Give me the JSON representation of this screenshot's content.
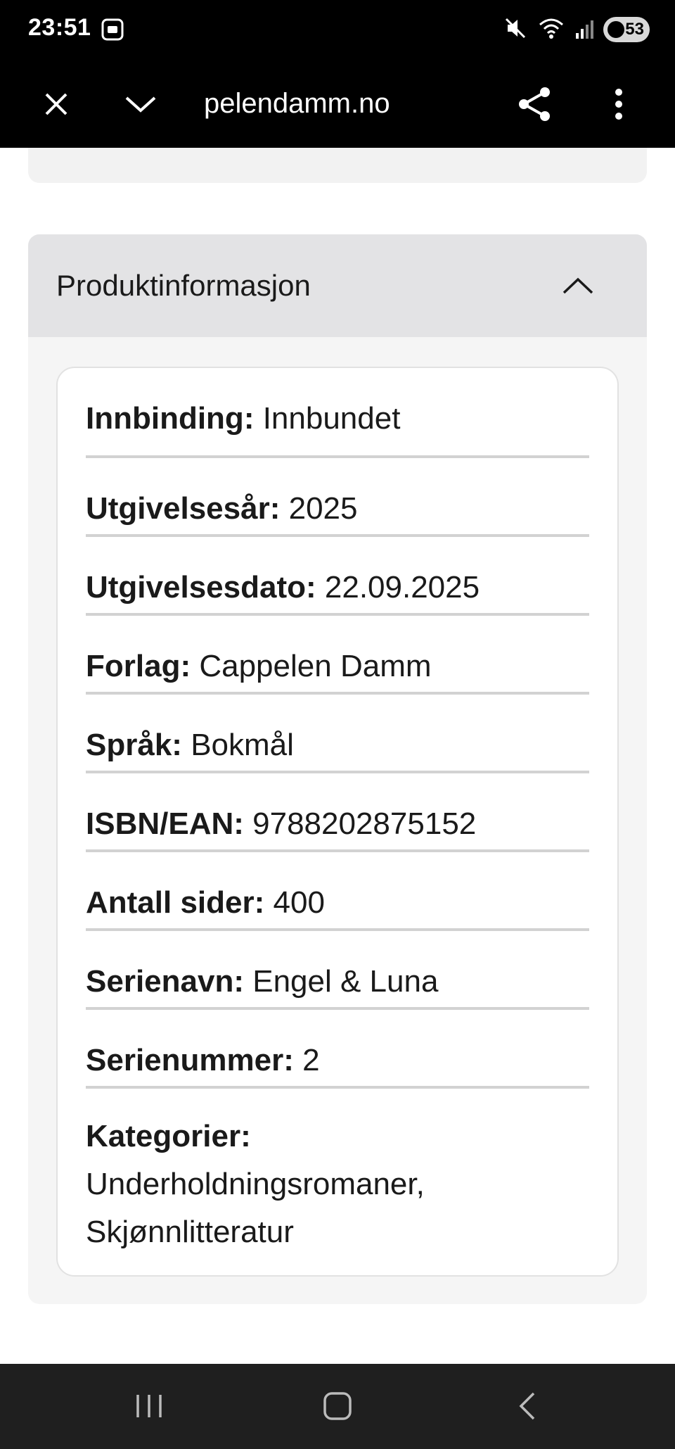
{
  "status_bar": {
    "time": "23:51",
    "battery": "53",
    "icons": [
      "screenshot-icon",
      "mute-icon",
      "wifi-icon",
      "signal-icon",
      "battery-icon"
    ]
  },
  "browser": {
    "url": "cappelendamm.no",
    "url_visible": "pelendamm.no",
    "icons": [
      "close-icon",
      "chevron-down-icon",
      "share-icon",
      "more-vert-icon"
    ]
  },
  "accordion": {
    "title": "Produktinformasjon",
    "expanded": true,
    "rows": [
      {
        "label": "Innbinding:",
        "value": "Innbundet"
      },
      {
        "label": "Utgivelsesår:",
        "value": "2025"
      },
      {
        "label": "Utgivelsesdato:",
        "value": "22.09.2025"
      },
      {
        "label": "Forlag:",
        "value": "Cappelen Damm"
      },
      {
        "label": "Språk:",
        "value": "Bokmål"
      },
      {
        "label": "ISBN/EAN:",
        "value": "9788202875152"
      },
      {
        "label": "Antall sider:",
        "value": "400"
      },
      {
        "label": "Serienavn:",
        "value": "Engel & Luna"
      },
      {
        "label": "Serienummer:",
        "value": "2"
      }
    ],
    "categories": {
      "label": "Kategorier:",
      "line1": "Underholdningsromaner,",
      "line2": "Skjønnlitteratur"
    }
  },
  "nav_bar": {
    "icons": [
      "recent-apps-icon",
      "home-icon",
      "back-icon"
    ]
  },
  "colors": {
    "header_bg": "#000000",
    "accordion_header_bg": "#e3e3e5",
    "accordion_bg": "#f5f5f5",
    "divider": "#d2d2d2"
  }
}
